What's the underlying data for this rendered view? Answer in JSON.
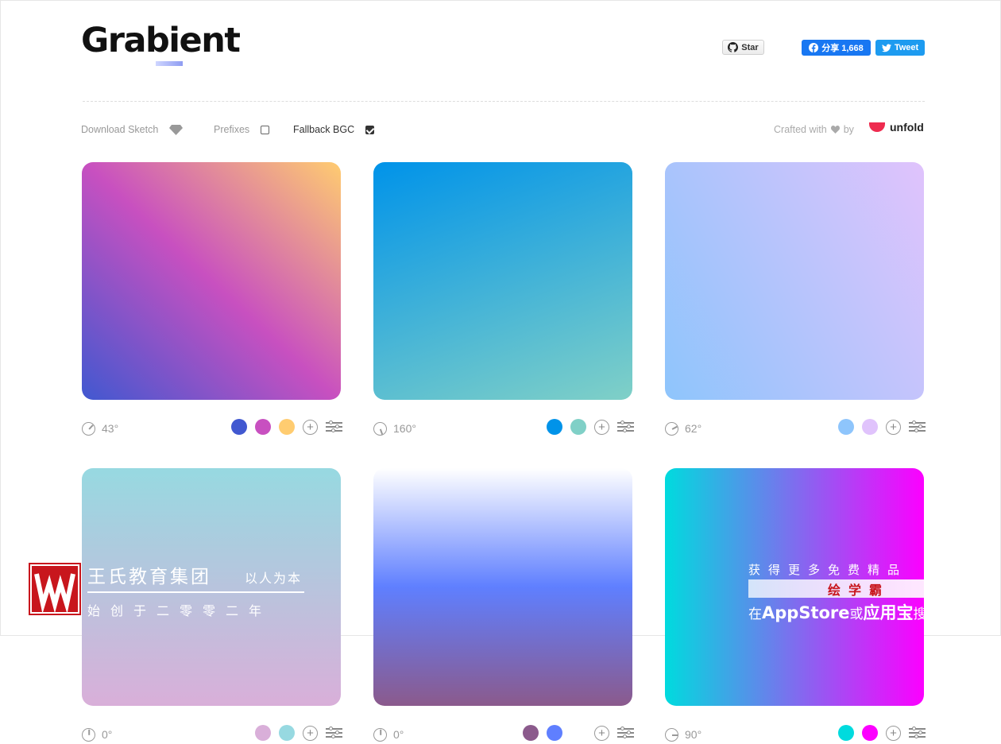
{
  "header": {
    "logo_text": "Grabient",
    "github_star_label": "Star",
    "facebook_share_label": "分享 1,668",
    "tweet_label": "Tweet"
  },
  "toolbar": {
    "download_sketch_label": "Download Sketch",
    "prefixes_label": "Prefixes",
    "prefixes_checked": false,
    "fallback_bgc_label": "Fallback BGC",
    "fallback_bgc_checked": true,
    "crafted_label": "Crafted with",
    "crafted_by_label": "by",
    "brand_label": "unfold"
  },
  "gradients": [
    {
      "angle": "43°",
      "angle_deg": 43,
      "colors": [
        "#4158D0",
        "#C850C0",
        "#FFCC70"
      ]
    },
    {
      "angle": "160°",
      "angle_deg": 160,
      "colors": [
        "#0093E9",
        "#80D0C7"
      ]
    },
    {
      "angle": "62°",
      "angle_deg": 62,
      "colors": [
        "#8EC5FC",
        "#E0C3FC"
      ]
    },
    {
      "angle": "0°",
      "angle_deg": 0,
      "colors": [
        "#D9AFD9",
        "#97D9E1"
      ]
    },
    {
      "angle": "0°",
      "angle_deg": 0,
      "colors": [
        "#8B5A8C",
        "#5F7FFF",
        "#FFFFFF"
      ]
    },
    {
      "angle": "90°",
      "angle_deg": 90,
      "colors": [
        "#00DBDE",
        "#FC00FF"
      ]
    }
  ],
  "watermark": {
    "left_title": "王氏教育集团",
    "left_motto": "以人为本",
    "left_subtitle": "始创于二零零二年",
    "right_line1": "获得更多免费精品",
    "right_line2": "绘学霸",
    "right_line3_prefix": "在",
    "right_line3_appstore": "AppStore",
    "right_line3_or": "或",
    "right_line3_yyb": "应用宝",
    "right_line3_suffix": "搜"
  }
}
